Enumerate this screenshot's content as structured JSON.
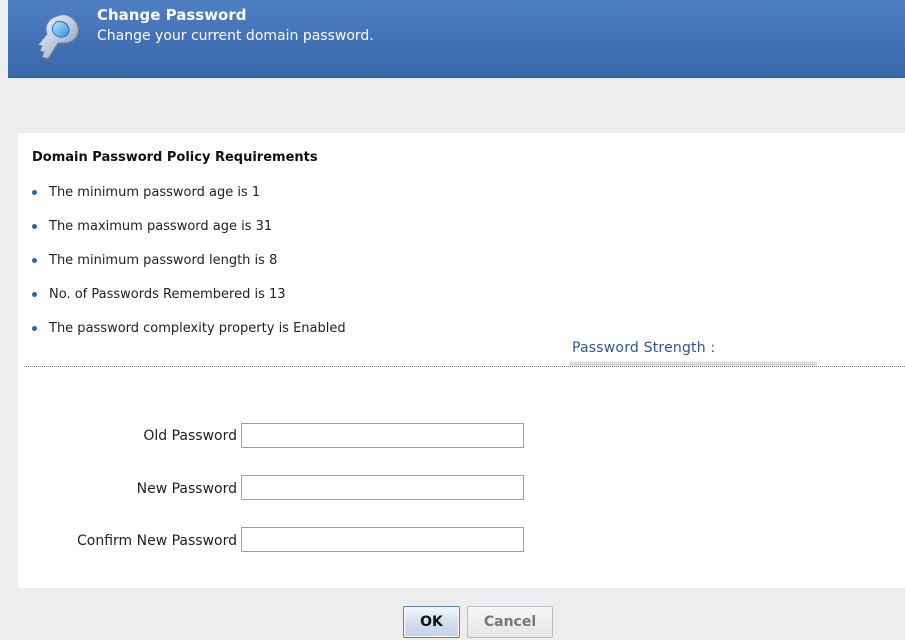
{
  "header": {
    "title": "Change Password",
    "subtitle": "Change your current domain password.",
    "icon": "key-icon",
    "background_color": "#3f6fb4"
  },
  "policy": {
    "heading": "Domain Password Policy Requirements",
    "items": [
      "The minimum password age is 1",
      "The maximum password age is 31",
      "The minimum password length is 8",
      "No. of Passwords Remembered is 13",
      "The password complexity property is Enabled"
    ],
    "bullet_color": "#2d62b0"
  },
  "form": {
    "old_password_label": "Old Password",
    "old_password_value": "",
    "new_password_label": "New Password",
    "new_password_value": "",
    "confirm_password_label": "Confirm New Password",
    "confirm_password_value": "",
    "strength_label": "Password Strength :",
    "strength_level": 0
  },
  "buttons": {
    "ok_label": "OK",
    "cancel_label": "Cancel"
  }
}
